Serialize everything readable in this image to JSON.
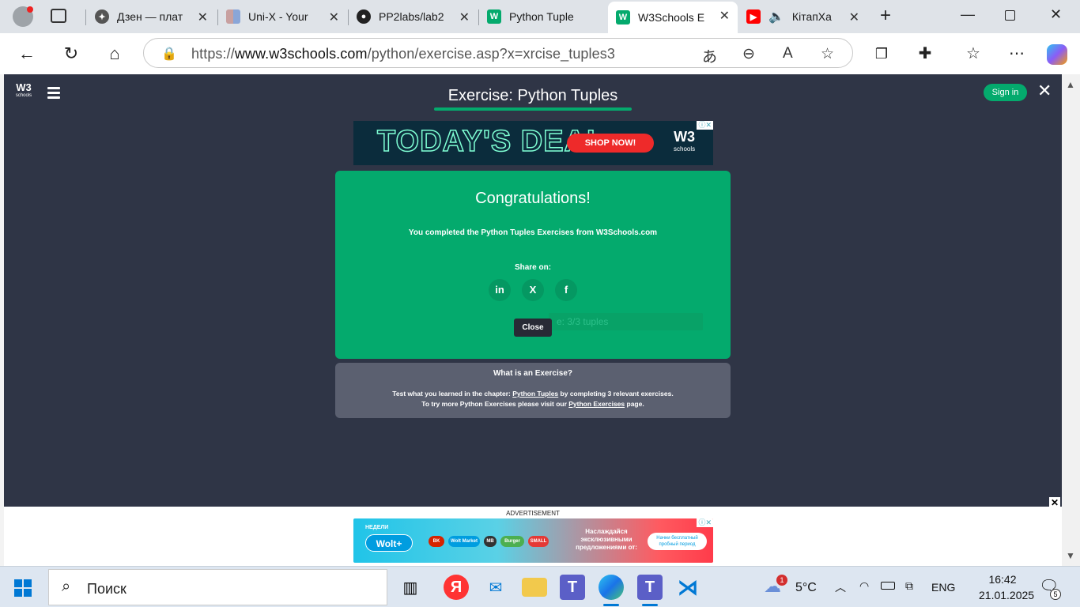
{
  "tabs": [
    {
      "title": "Дзен — плат",
      "icon": "dzen-icon"
    },
    {
      "title": "Uni-X - Your",
      "icon": "unix-icon"
    },
    {
      "title": "PP2labs/lab2",
      "icon": "github-icon"
    },
    {
      "title": "Python Tuple",
      "icon": "w3schools-icon"
    },
    {
      "title": "W3Schools E",
      "icon": "w3schools-icon",
      "active": true
    },
    {
      "title": "КітапХа",
      "icon": "youtube-icon"
    }
  ],
  "address": {
    "prefix": "https://",
    "domain": "www.w3schools.com",
    "path": "/python/exercise.asp?x=xrcise_tuples3"
  },
  "header": {
    "logo": "W3",
    "logo_sub": "schools",
    "title": "Exercise: Python Tuples",
    "sign_in": "Sign in",
    "close": "✕"
  },
  "ad_top": {
    "headline": "TODAY'S DEAL",
    "button": "SHOP NOW!",
    "brand": "W3",
    "brand_sub": "schools"
  },
  "congrats": {
    "title": "Congratulations!",
    "message": "You completed the Python Tuples Exercises from W3Schools.com",
    "share_label": "Share on:",
    "share": [
      {
        "label": "in",
        "name": "linkedin"
      },
      {
        "label": "X",
        "name": "x"
      },
      {
        "label": "f",
        "name": "facebook"
      }
    ],
    "close_button": "Close",
    "ghost_text": "e: 3/3 tuples"
  },
  "info": {
    "question": "What is an Exercise?",
    "line1_pre": "Test what you learned in the chapter: ",
    "line1_link": "Python Tuples",
    "line1_post": " by completing 3 relevant exercises.",
    "line2_pre": "To try more Python Exercises please visit our ",
    "line2_link": "Python Exercises",
    "line2_post": " page."
  },
  "ad_bottom": {
    "label": "ADVERTISEMENT",
    "weeks": "НЕДЕЛИ",
    "wolt": "Wolt+",
    "text": "Наслаждайся эксклюзивными предложениями от:",
    "cta": "Начни бесплатный пробный период",
    "brands": [
      "BK",
      "Wolt Market",
      "MB",
      "Burger",
      "SMALL"
    ]
  },
  "taskbar": {
    "search_placeholder": "Поиск",
    "weather_temp": "5°C",
    "weather_badge": "1",
    "lang": "ENG",
    "time": "16:42",
    "date": "21.01.2025",
    "notif_count": "5"
  },
  "colors": {
    "page_bg": "#2f3546",
    "accent": "#04aa6d",
    "info_bg": "#5b6070"
  }
}
